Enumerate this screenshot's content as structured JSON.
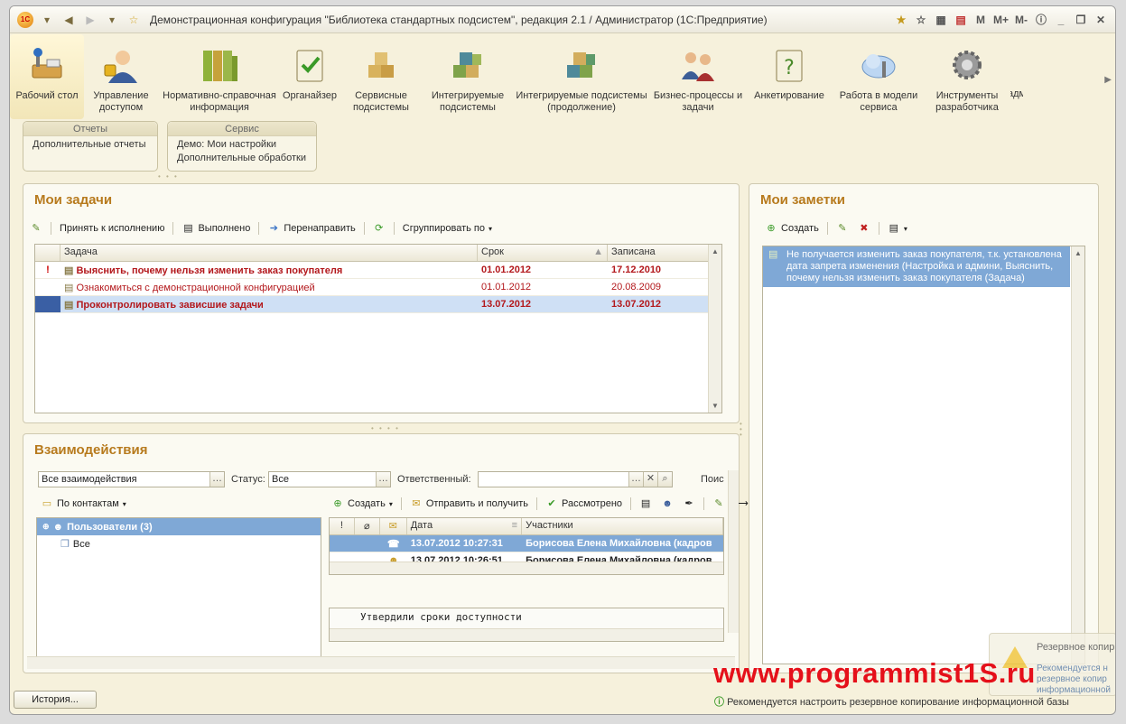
{
  "window": {
    "title": "Демонстрационная конфигурация \"Библиотека стандартных подсистем\", редакция 2.1 / Администратор  (1С:Предприятие)"
  },
  "titlebar_buttons": [
    "M",
    "M+",
    "M-"
  ],
  "sections": [
    {
      "label": "Рабочий стол",
      "icon": "desktop-icon"
    },
    {
      "label": "Управление доступом",
      "icon": "access-user-icon"
    },
    {
      "label": "Нормативно-справочная информация",
      "icon": "binders-icon"
    },
    {
      "label": "Органайзер",
      "icon": "clipboard-check-icon"
    },
    {
      "label": "Сервисные подсистемы",
      "icon": "boxes-icon"
    },
    {
      "label": "Интегрируемые подсистемы",
      "icon": "cubes-icon"
    },
    {
      "label": "Интегрируемые подсистемы (продолжение)",
      "icon": "cubes-continued-icon"
    },
    {
      "label": "Бизнес-процессы и задачи",
      "icon": "people-icon"
    },
    {
      "label": "Анкетирование",
      "icon": "survey-icon"
    },
    {
      "label": "Работа в модели сервиса",
      "icon": "cloud-icon"
    },
    {
      "label": "Инструменты разработчика",
      "icon": "gear-icon"
    },
    {
      "label": "адм",
      "icon": "admin-icon"
    }
  ],
  "groups": {
    "reports": {
      "title": "Отчеты",
      "items": [
        "Дополнительные отчеты"
      ]
    },
    "service": {
      "title": "Сервис",
      "items": [
        "Демо: Мои настройки",
        "Дополнительные обработки"
      ]
    }
  },
  "tasks": {
    "title": "Мои задачи",
    "toolbar": [
      "Принять к исполнению",
      "Выполнено",
      "Перенаправить",
      "Сгруппировать по"
    ],
    "columns": [
      "Задача",
      "Срок",
      "Записана"
    ],
    "rows": [
      {
        "title": "Выяснить, почему нельзя изменить заказ покупателя",
        "due": "01.01.2012",
        "created": "17.12.2010",
        "important": "!"
      },
      {
        "title": "Ознакомиться с демонстрационной конфигурацией",
        "due": "01.01.2012",
        "created": "20.08.2009",
        "important": ""
      },
      {
        "title": "Проконтролировать зависшие задачи",
        "due": "13.07.2012",
        "created": "13.07.2012",
        "important": ""
      }
    ]
  },
  "notes": {
    "title": "Мои заметки",
    "create_label": "Создать",
    "items": [
      "Не получается изменить заказ покупателя, т.к. установлена дата запрета изменения (Настройка и админи, Выяснить, почему нельзя изменить заказ покупателя (Задача)"
    ]
  },
  "interactions": {
    "title": "Взаимодействия",
    "filter_value": "Все взаимодействия",
    "status_label": "Статус:",
    "status_value": "Все",
    "responsible_label": "Ответственный:",
    "search_label": "Поис",
    "by_contacts_label": "По контактам",
    "tree": [
      {
        "label": "Пользователи (3)",
        "selected": true
      },
      {
        "label": "Все",
        "selected": false
      }
    ],
    "toolbar": [
      "Создать",
      "Отправить и получить",
      "Рассмотрено"
    ],
    "columns": [
      "Дата",
      "Участники"
    ],
    "rows": [
      {
        "date": "13.07.2012 10:27:31",
        "participants": "Борисова Елена Михайловна (кадров"
      },
      {
        "date": "13.07.2012 10:26:51",
        "participants": "Борисова Елена Михайловна (кадров"
      }
    ],
    "preview_text": "Утвердили сроки доступности"
  },
  "status": {
    "history_button": "История...",
    "message": "Рекомендуется настроить резервное копирование информационной базы"
  },
  "notification": {
    "title": "Резервное копир",
    "text_lines": [
      "Рекомендуется н",
      "резервное копир",
      "информационной"
    ]
  },
  "watermark": "www.programmist1S.ru",
  "colors": {
    "accent": "#b77a1d",
    "important": "#b3181c",
    "selection": "#7fa8d6",
    "watermark": "#e5101a"
  }
}
